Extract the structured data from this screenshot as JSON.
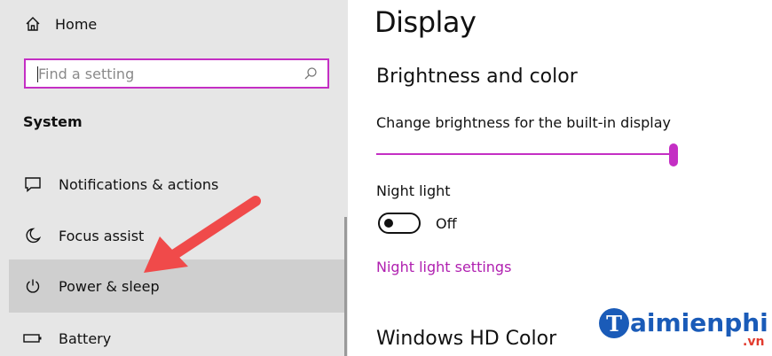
{
  "sidebar": {
    "home_label": "Home",
    "search_placeholder": "Find a setting",
    "section_title": "System",
    "items": [
      {
        "label": "Notifications & actions",
        "icon": "message-icon"
      },
      {
        "label": "Focus assist",
        "icon": "moon-icon"
      },
      {
        "label": "Power & sleep",
        "icon": "power-icon",
        "selected": true
      },
      {
        "label": "Battery",
        "icon": "battery-icon"
      }
    ]
  },
  "main": {
    "title": "Display",
    "section_brightness": "Brightness and color",
    "brightness_label": "Change brightness for the built-in display",
    "brightness_value": 1.0,
    "night_light_label": "Night light",
    "night_light_state": "Off",
    "night_light_link": "Night light settings",
    "section_hd": "Windows HD Color"
  },
  "watermark": {
    "letter": "T",
    "text": "aimienphi",
    "suffix": ".vn"
  },
  "colors": {
    "accent": "#c42fc4",
    "link": "#b020b0",
    "sidebar_bg": "#e6e6e6",
    "selected_bg": "#cfcfcf",
    "arrow": "#f04a4a",
    "watermark_blue": "#1a5bb8",
    "watermark_red": "#e23b2e"
  }
}
